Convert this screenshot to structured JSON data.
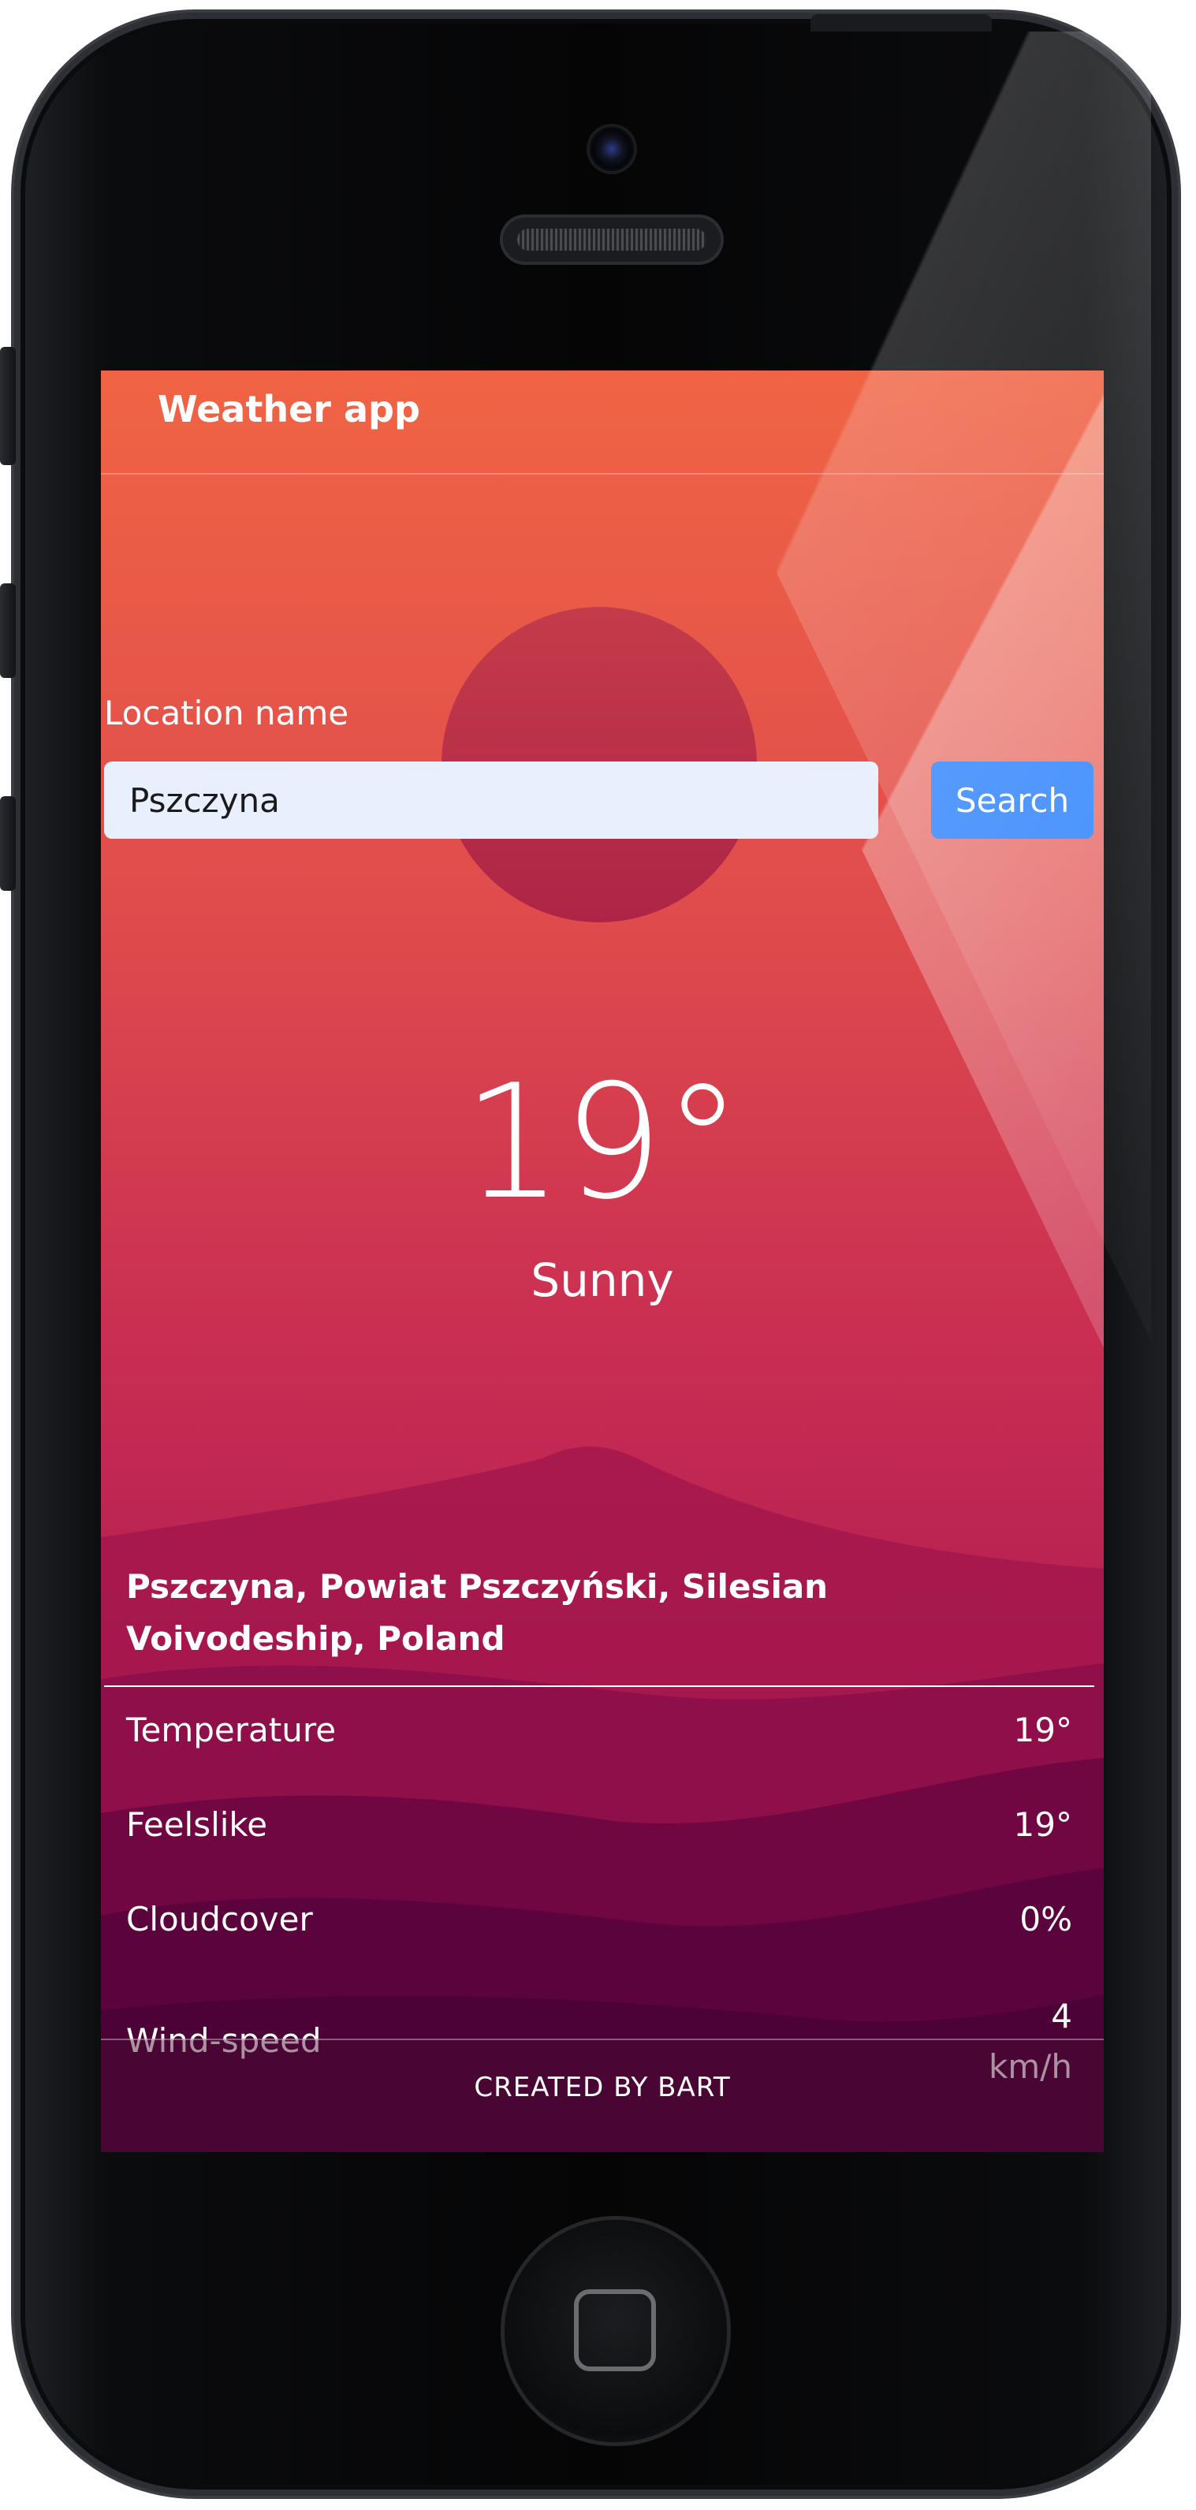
{
  "app": {
    "brand": "Weather app"
  },
  "search": {
    "label": "Location name",
    "value": "Pszczyna",
    "button_label": "Search"
  },
  "current": {
    "temperature": "19°",
    "condition": "Sunny"
  },
  "location": {
    "full_name": "Pszczyna, Powiat Pszczyński, Silesian Voivodeship, Poland"
  },
  "details": [
    {
      "label": "Temperature",
      "value": "19°"
    },
    {
      "label": "Feelslike",
      "value": "19°"
    },
    {
      "label": "Cloudcover",
      "value": "0%"
    },
    {
      "label": "Wind-speed",
      "value": "4 km/h"
    }
  ],
  "footer": {
    "text": "CREATED BY BART"
  },
  "colors": {
    "gradient_top": "#f06444",
    "gradient_bottom": "#8f1049",
    "search_button": "#3d8bfd",
    "input_background": "#e8f0fe"
  }
}
